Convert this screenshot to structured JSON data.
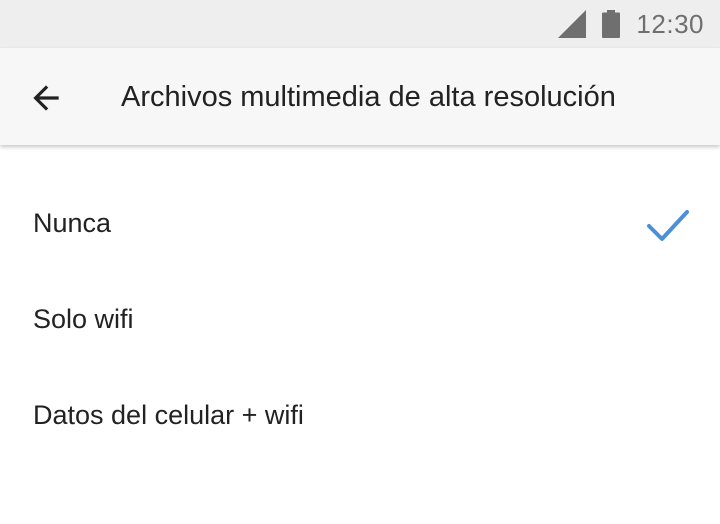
{
  "status_bar": {
    "time": "12:30",
    "signal_icon": "signal-icon",
    "battery_icon": "battery-icon"
  },
  "header": {
    "back_icon": "arrow-back-icon",
    "title": "Archivos multimedia de alta resolución"
  },
  "options": [
    {
      "label": "Nunca",
      "selected": true
    },
    {
      "label": "Solo wifi",
      "selected": false
    },
    {
      "label": "Datos del celular + wifi",
      "selected": false
    }
  ],
  "colors": {
    "accent": "#4a90d9",
    "status_bar_bg": "#eeeeee",
    "app_bar_bg": "#f7f7f7",
    "text_primary": "#222222",
    "status_text": "#6f6f6f"
  }
}
